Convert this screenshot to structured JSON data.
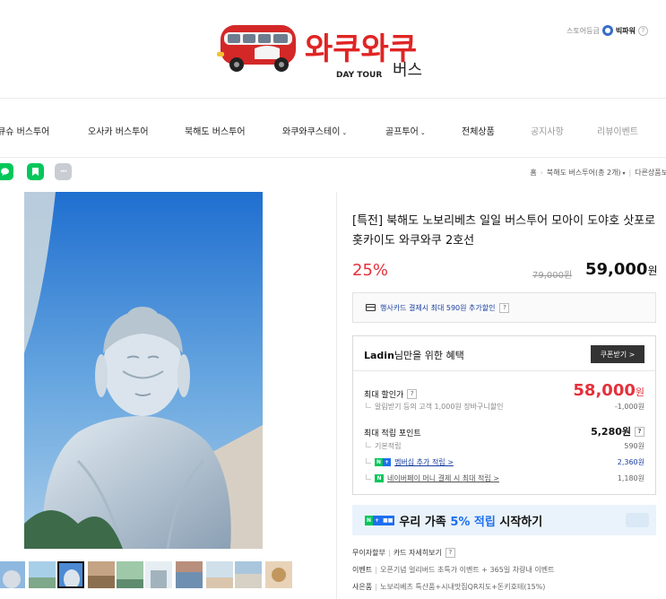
{
  "header": {
    "logo_text": "와쿠와쿠",
    "logo_sub": "DAY TOUR",
    "logo_bus": "버스",
    "store_grade_label": "스토어등급",
    "store_grade_value": "빅파워",
    "store_grade_help": "?"
  },
  "nav": {
    "items": [
      {
        "label": "큐슈 버스투어",
        "muted": false
      },
      {
        "label": "오사카 버스투어",
        "muted": false
      },
      {
        "label": "북해도 버스투어",
        "muted": false
      },
      {
        "label": "와쿠와쿠스테이",
        "muted": false,
        "dropdown": true
      },
      {
        "label": "골프투어",
        "muted": false,
        "dropdown": true
      },
      {
        "label": "전체상품",
        "muted": false
      },
      {
        "label": "공지사항",
        "muted": true
      },
      {
        "label": "리뷰이벤트",
        "muted": true
      }
    ],
    "caret": "⌄"
  },
  "actions": {
    "more_label": "···"
  },
  "breadcrumb": {
    "home": "홈",
    "category": "북해도 버스투어(총 2개)",
    "other": "다른상품보"
  },
  "product": {
    "title": "[특전] 북해도 노보리베츠 일일 버스투어 모아이 도야호 삿포로 홋카이도 와쿠와쿠 2호선",
    "discount_rate": "25%",
    "original_price": "79,000원",
    "sale_price": "59,000",
    "sale_currency": "원",
    "card_benefit": "행사카드 결제시 최대 590원 추가할인",
    "help": "?"
  },
  "benefits": {
    "heading_user": "Ladin",
    "heading_suffix": "님만을 위한 혜택",
    "coupon_button": "쿠폰받기 >",
    "max_discount_label": "최대 할인가",
    "max_discount_value": "58,000",
    "max_discount_currency": "원",
    "alarm_label": "알림받기 등의 고객 1,000원 장바구니할인",
    "alarm_value": "-1,000원",
    "max_point_label": "최대 적립 포인트",
    "max_point_value": "5,280원",
    "basic_label": "기본적립",
    "basic_value": "590원",
    "membership_label": "멤버십 추가 적립 >",
    "membership_value": "2,360원",
    "naverpay_label": "네이버페이 머니 결제 시 최대 적립 >",
    "naverpay_value": "1,180원"
  },
  "family": {
    "text_before": "우리 가족 ",
    "highlight": "5% 적립",
    "text_after": " 시작하기"
  },
  "info": {
    "installment": "무이자할부",
    "card_detail": "카드 자세히보기",
    "event_label": "이벤트",
    "event_text": "오픈기념 얼리버드 초특가 이벤트 + 365일 차량내 이벤트",
    "gift_label": "사은품",
    "gift_text": "노보리베츠 특산품+시내맛집QR지도+돈키호테(15%)"
  },
  "colors": {
    "discount_red": "#e5303b",
    "naver_green": "#03c75a",
    "link_blue": "#1a3fa0",
    "banner_bg": "#eaf3fb"
  }
}
